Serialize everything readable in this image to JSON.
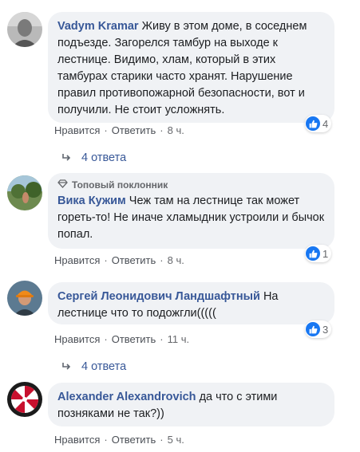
{
  "comments": [
    {
      "author": "Vadym Kramar",
      "text": "Живу в этом доме, в соседнем подъезде. Загорелся тамбур на выходе к лестнице. Видимо, хлам, который в этих тамбурах старики часто хранят. Нарушение правил противопожарной безопасности, вот и получили. Не стоит усложнять.",
      "like_label": "Нравится",
      "reply_label": "Ответить",
      "time": "8 ч.",
      "reaction_count": "4",
      "replies_label": "4 ответа"
    },
    {
      "badge": "Топовый поклонник",
      "author": "Вика Кужим",
      "text": "Чеж там на лестнице так может гореть-то! Не иначе хламыдник устроили и бычок попал.",
      "like_label": "Нравится",
      "reply_label": "Ответить",
      "time": "8 ч.",
      "reaction_count": "1"
    },
    {
      "author": "Сергей Леонидович Ландшафтный",
      "text": "На лестнице что то подожгли(((((",
      "like_label": "Нравится",
      "reply_label": "Ответить",
      "time": "11 ч.",
      "reaction_count": "3",
      "replies_label": "4 ответа"
    },
    {
      "author": "Alexander Alexandrovich",
      "text": "да что с этими позняками не так?))",
      "like_label": "Нравится",
      "reply_label": "Ответить",
      "time": "5 ч."
    }
  ],
  "colors": {
    "author": "#385898",
    "bubble": "#f0f2f5",
    "like": "#1877f2",
    "meta": "#65676b"
  },
  "icons": {
    "reaction": "like-thumb-icon",
    "replies": "reply-arrow-icon",
    "badge": "diamond-icon"
  }
}
